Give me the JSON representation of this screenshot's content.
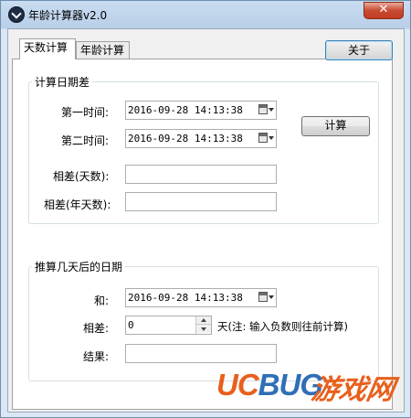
{
  "window": {
    "title": "年龄计算器v2.0",
    "close_glyph": "✕"
  },
  "tabs": [
    {
      "label": "天数计算",
      "active": true
    },
    {
      "label": "年龄计算",
      "active": false
    }
  ],
  "about_label": "关于",
  "group1": {
    "title": "计算日期差",
    "first_time_label": "第一时间:",
    "first_time_value": "2016-09-28 14:13:38",
    "second_time_label": "第二时间:",
    "second_time_value": "2016-09-28 14:13:38",
    "calc_label": "计算",
    "diff_days_label": "相差(天数):",
    "diff_days_value": "",
    "diff_years_label": "相差(年天数):",
    "diff_years_value": ""
  },
  "group2": {
    "title": "推算几天后的日期",
    "and_label": "和:",
    "and_value": "2016-09-28 14:13:38",
    "diff_label": "相差:",
    "diff_value": "0",
    "diff_note": "天(注: 输入负数则往前计算)",
    "result_label": "结果:",
    "result_value": ""
  },
  "watermark": {
    "latin_uc": "UC",
    "latin_bug": "BUG",
    "chinese": "游戏网"
  },
  "colors": {
    "accent_orange": "#e8601c",
    "accent_blue": "#2f6fb6",
    "close_red": "#c74b32"
  }
}
